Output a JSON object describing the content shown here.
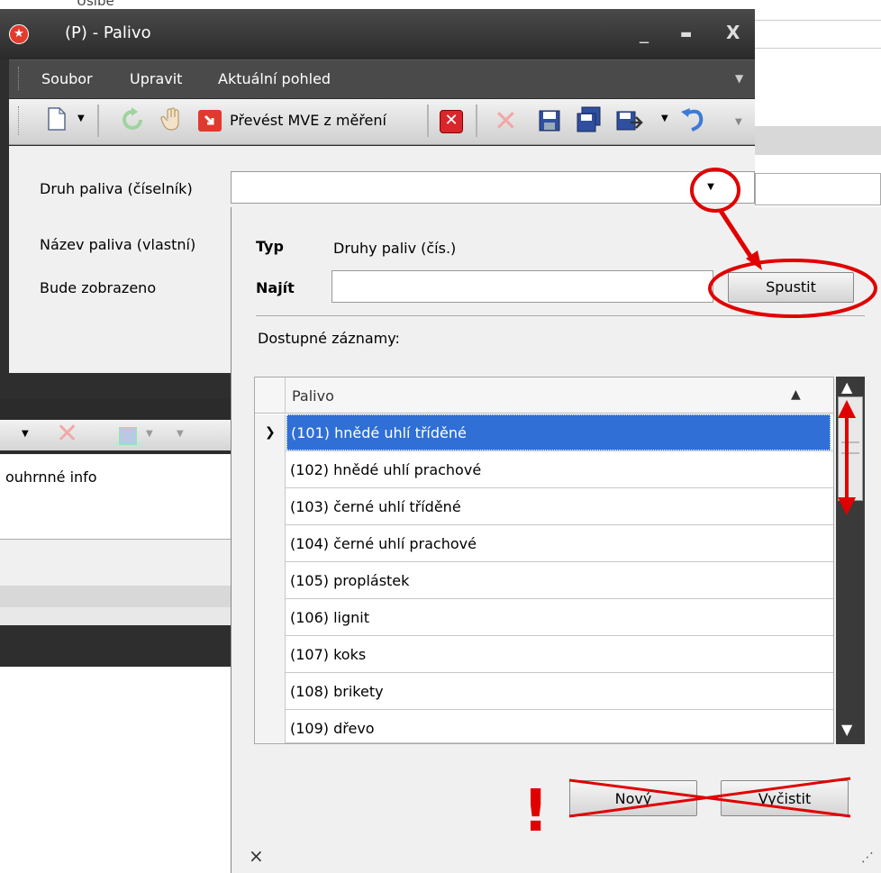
{
  "background": {
    "partial_top_text": "Ušíbe",
    "lower_panel_label": "ouhrnné info"
  },
  "window": {
    "title": "(P) - Palivo",
    "controls": {
      "minimize": "_",
      "maximize": "▬",
      "close": "X"
    }
  },
  "menu": {
    "items": [
      "Soubor",
      "Upravit",
      "Aktuální pohled"
    ]
  },
  "toolbar": {
    "convert_label": "Převést MVE z měření"
  },
  "form": {
    "druh_label": "Druh paliva (číselník)",
    "druh_value": "",
    "nazev_label": "Název paliva (vlastní)",
    "zobrazeno_label": "Bude zobrazeno"
  },
  "lookup": {
    "typ_label": "Typ",
    "typ_value": "Druhy paliv (čís.)",
    "najit_label": "Najít",
    "najit_value": "",
    "run_button": "Spustit",
    "available_label": "Dostupné záznamy:",
    "column_header": "Palivo",
    "rows": [
      "(101) hnědé uhlí tříděné",
      "(102) hnědé uhlí prachové",
      "(103) černé uhlí tříděné",
      "(104) černé uhlí prachové",
      "(105) proplástek",
      "(106) lignit",
      "(107) koks",
      "(108) brikety",
      "(109) dřevo"
    ],
    "selected_index": 0,
    "new_button": "Nový",
    "clear_button": "Vyčistit",
    "close_glyph": "×"
  },
  "annotations": {
    "exclamation": "!"
  },
  "colors": {
    "selection": "#2f6fd6",
    "annotation_red": "#e00000"
  }
}
